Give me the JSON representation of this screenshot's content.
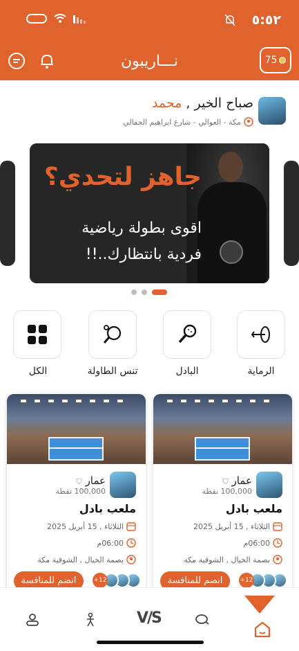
{
  "status": {
    "time": "٥:٥٢"
  },
  "header": {
    "title": "نـــاريبون",
    "points": "75",
    "colors": {
      "accent": "#E0622C"
    }
  },
  "user": {
    "greeting": "صباح الخير ,",
    "name": "محمد",
    "location": "مكة - العوالي - شارع ابراهيم الجفالي"
  },
  "banner": {
    "title": "جاهز لتحدي؟",
    "line1": "اقوى بطولة رياضية",
    "line2": "فردية بانتظارك..!!"
  },
  "categories": [
    {
      "label": "الرماية",
      "icon": "archery-target-icon"
    },
    {
      "label": "البادل",
      "icon": "padel-racket-icon"
    },
    {
      "label": "تنس الطاولة",
      "icon": "table-tennis-icon"
    },
    {
      "label": "الكل",
      "icon": "grid-icon"
    }
  ],
  "cards": [
    {
      "player": "عمار",
      "points": "100,000 نقطة",
      "title": "ملعب بادل",
      "date": "الثلاثاء , 15 أبريل 2025",
      "time": "06:00م",
      "location": "بصمة الخيال , الشوقية مكة",
      "join": "انضم للمنافسة",
      "more": "+12"
    },
    {
      "player": "عمار",
      "points": "100,000 نقطة",
      "title": "ملعب بادل",
      "date": "الثلاثاء , 15 أبريل 2025",
      "time": "06:00م",
      "location": "بصمة الخيال , الشوقية مكة",
      "join": "انضم للمنافسة",
      "more": "+12"
    }
  ],
  "nav": {
    "vs_label": "V/S"
  }
}
